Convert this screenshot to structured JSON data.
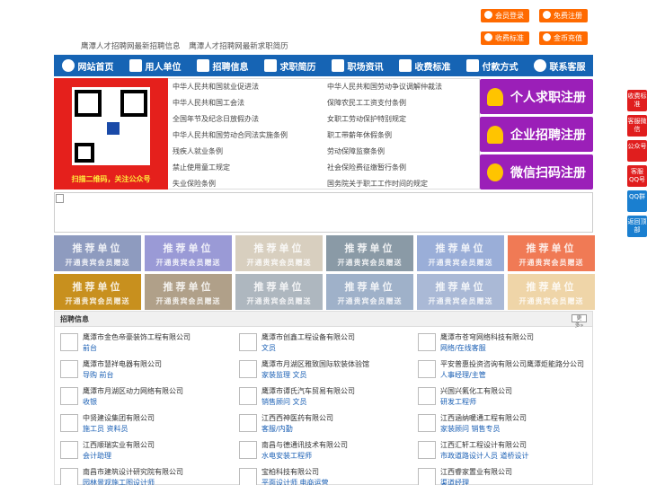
{
  "top_links": [
    "鹰潭人才招聘网最新招聘信息",
    "鹰潭人才招聘网最新求职简历"
  ],
  "top_buttons": {
    "login": "会员登录",
    "register": "免费注册",
    "fees": "收费标准",
    "recharge": "金币充值"
  },
  "nav": [
    {
      "label": "网站首页",
      "icon": "home-icon"
    },
    {
      "label": "用人单位",
      "icon": "building-icon"
    },
    {
      "label": "招聘信息",
      "icon": "recruit-icon"
    },
    {
      "label": "求职简历",
      "icon": "resume-icon"
    },
    {
      "label": "职场资讯",
      "icon": "news-icon"
    },
    {
      "label": "收费标准",
      "icon": "pricing-icon"
    },
    {
      "label": "付款方式",
      "icon": "payment-icon"
    },
    {
      "label": "联系客服",
      "icon": "service-icon"
    }
  ],
  "qr_caption": "扫描二维码，关注公众号",
  "laws": [
    "中华人民共和国就业促进法",
    "中华人民共和国劳动争议调解仲裁法",
    "中华人民共和国工会法",
    "保障农民工工资支付条例",
    "全国年节及纪念日放假办法",
    "女职工劳动保护特别规定",
    "中华人民共和国劳动合同法实施条例",
    "职工带薪年休假条例",
    "残疾人就业条例",
    "劳动保障监察条例",
    "禁止使用童工规定",
    "社会保险费征缴暂行条例",
    "失业保险条例",
    "国务院关于职工工作时间的规定"
  ],
  "register_buttons": [
    "个人求职注册",
    "企业招聘注册",
    "微信扫码注册"
  ],
  "promo": {
    "title": "推荐单位",
    "subtitle": "开通贵宾会员赠送"
  },
  "promo_colors": [
    "#8e9bbf",
    "#9a9ad6",
    "#d8cfbf",
    "#8a9aa6",
    "#9aaed8",
    "#f07a55",
    "#c8901e",
    "#b0a089",
    "#aeb7bf",
    "#9fb1c9",
    "#aab9d6",
    "#efd5a8"
  ],
  "jobs_section": {
    "title": "招聘信息",
    "more": "更多»"
  },
  "jobs": [
    {
      "company": "鹰潭市金色帝豪装饰工程有限公司",
      "positions": "前台"
    },
    {
      "company": "鹰潭市创鑫工程设备有限公司",
      "positions": "文员"
    },
    {
      "company": "鹰潭市苍穹网络科技有限公司",
      "positions": "网络/在线客服"
    },
    {
      "company": "鹰潭市慧祥电器有限公司",
      "positions": "导购 前台"
    },
    {
      "company": "鹰潭市月湖区雅致国际软装体验馆",
      "positions": "家装监理 文员"
    },
    {
      "company": "平安普惠投资咨询有限公司鹰潭炬能路分公司",
      "positions": "人事经理/主管"
    },
    {
      "company": "鹰潭市月湖区动力网络有限公司",
      "positions": "收银"
    },
    {
      "company": "鹰潭市谭氏汽车贸易有限公司",
      "positions": "销售顾问 文员"
    },
    {
      "company": "兴国兴氟化工有限公司",
      "positions": "研发工程师"
    },
    {
      "company": "中贤建设集团有限公司",
      "positions": "施工员 资料员"
    },
    {
      "company": "江西西神医药有限公司",
      "positions": "客服/内勤"
    },
    {
      "company": "江西涵纳暖通工程有限公司",
      "positions": "家装顾问 销售专员"
    },
    {
      "company": "江西顺瑞实业有限公司",
      "positions": "会计助理"
    },
    {
      "company": "南昌与德通讯技术有限公司",
      "positions": "水电安装工程师"
    },
    {
      "company": "江西汇轩工程设计有限公司",
      "positions": "市政道路设计人员 道桥设计"
    },
    {
      "company": "南昌市建筑设计研究院有限公司",
      "positions": "园林景观施工图设计师"
    },
    {
      "company": "宝柏科技有限公司",
      "positions": "平面设计师 电商运营"
    },
    {
      "company": "江西睿家置业有限公司",
      "positions": "渠道经理"
    }
  ],
  "side_buttons": [
    "收费标准",
    "客服微信",
    "公众号",
    "客服QQ号",
    "QQ群",
    "返回顶部"
  ]
}
